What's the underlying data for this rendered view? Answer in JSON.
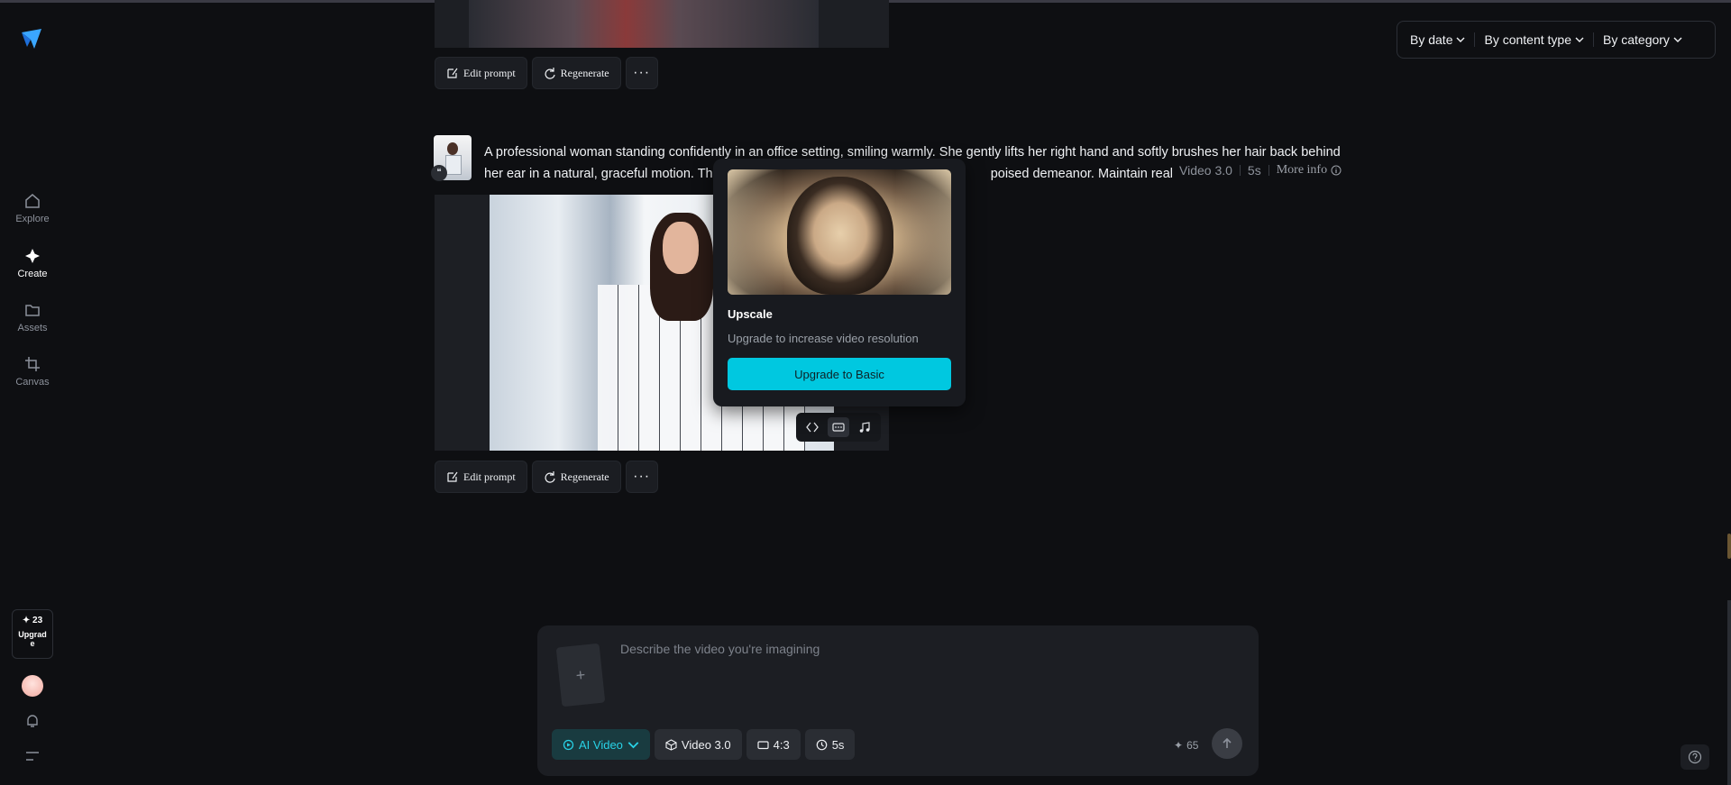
{
  "sidebar": {
    "items": [
      {
        "label": "Explore",
        "icon": "home-icon"
      },
      {
        "label": "Create",
        "icon": "sparkle-icon",
        "active": true
      },
      {
        "label": "Assets",
        "icon": "folder-icon"
      },
      {
        "label": "Canvas",
        "icon": "canvas-crop-icon"
      }
    ],
    "credits": "23",
    "upgrade_label": "Upgrad\ne"
  },
  "filters": {
    "by_date": "By date",
    "by_content_type": "By content type",
    "by_category": "By category"
  },
  "actions": {
    "edit_prompt": "Edit prompt",
    "regenerate": "Regenerate",
    "more": "···"
  },
  "generation": {
    "prompt_line1": "A professional woman standing confidently in an office setting, smiling warmly. She gently lifts her right hand and softly brushes her hair back behind",
    "prompt_line2": "her ear in a natural, graceful motion. The",
    "prompt_line2_tail": "poised demeanor. Maintain realistic",
    "model": "Video 3.0",
    "duration": "5s",
    "more_info": "More info"
  },
  "popover": {
    "title": "Upscale",
    "description": "Upgrade to increase video resolution",
    "button": "Upgrade to Basic"
  },
  "composer": {
    "placeholder": "Describe the video you're imagining",
    "mode": "AI Video",
    "model": "Video 3.0",
    "aspect": "4:3",
    "duration": "5s",
    "credits": "65"
  },
  "colors": {
    "accent": "#00c8e0",
    "background": "#0e0f12"
  }
}
